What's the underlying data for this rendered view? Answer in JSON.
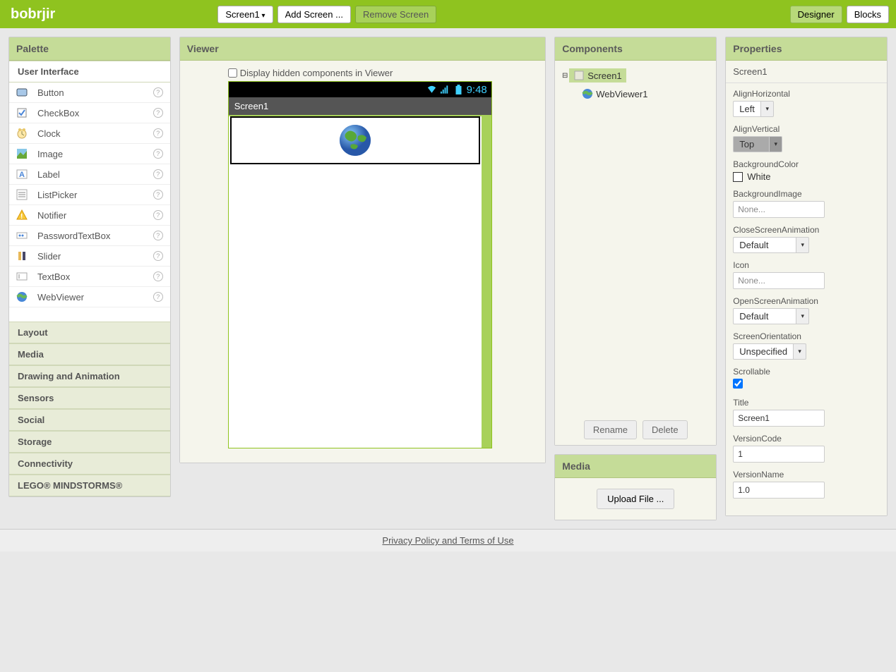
{
  "topbar": {
    "title": "bobrjir",
    "screen_dropdown": "Screen1",
    "add_screen": "Add Screen ...",
    "remove_screen": "Remove Screen",
    "designer": "Designer",
    "blocks": "Blocks"
  },
  "palette": {
    "header": "Palette",
    "sections": {
      "user_interface": "User Interface",
      "layout": "Layout",
      "media": "Media",
      "drawing": "Drawing and Animation",
      "sensors": "Sensors",
      "social": "Social",
      "storage": "Storage",
      "connectivity": "Connectivity",
      "lego": "LEGO® MINDSTORMS®"
    },
    "items": {
      "button": "Button",
      "checkbox": "CheckBox",
      "clock": "Clock",
      "image": "Image",
      "label": "Label",
      "listpicker": "ListPicker",
      "notifier": "Notifier",
      "password": "PasswordTextBox",
      "slider": "Slider",
      "textbox": "TextBox",
      "webviewer": "WebViewer"
    }
  },
  "viewer": {
    "header": "Viewer",
    "hidden_label": "Display hidden components in Viewer",
    "phone_time": "9:48",
    "screen_title": "Screen1"
  },
  "components": {
    "header": "Components",
    "screen1": "Screen1",
    "webviewer1": "WebViewer1",
    "rename": "Rename",
    "delete": "Delete"
  },
  "media": {
    "header": "Media",
    "upload": "Upload File ..."
  },
  "properties": {
    "header": "Properties",
    "component": "Screen1",
    "align_horizontal": {
      "label": "AlignHorizontal",
      "value": "Left"
    },
    "align_vertical": {
      "label": "AlignVertical",
      "value": "Top"
    },
    "background_color": {
      "label": "BackgroundColor",
      "value": "White"
    },
    "background_image": {
      "label": "BackgroundImage",
      "value": "None..."
    },
    "close_anim": {
      "label": "CloseScreenAnimation",
      "value": "Default"
    },
    "icon": {
      "label": "Icon",
      "value": "None..."
    },
    "open_anim": {
      "label": "OpenScreenAnimation",
      "value": "Default"
    },
    "screen_orientation": {
      "label": "ScreenOrientation",
      "value": "Unspecified"
    },
    "scrollable": {
      "label": "Scrollable"
    },
    "title": {
      "label": "Title",
      "value": "Screen1"
    },
    "version_code": {
      "label": "VersionCode",
      "value": "1"
    },
    "version_name": {
      "label": "VersionName",
      "value": "1.0"
    }
  },
  "footer": {
    "link": "Privacy Policy and Terms of Use"
  }
}
